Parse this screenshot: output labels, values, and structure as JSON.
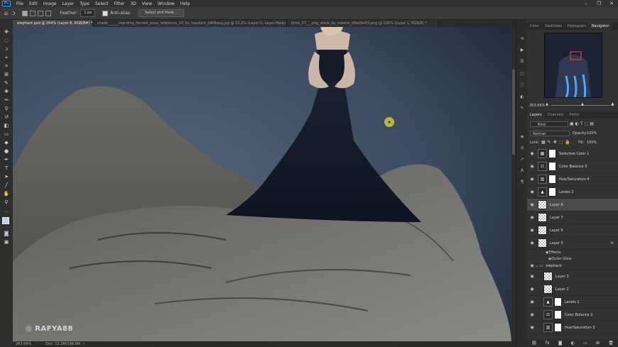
{
  "menu": {
    "items": [
      "File",
      "Edit",
      "Image",
      "Layer",
      "Type",
      "Select",
      "Filter",
      "3D",
      "View",
      "Window",
      "Help"
    ],
    "window_controls": [
      "–",
      "❐",
      "✕"
    ]
  },
  "options": {
    "feather_label": "Feather:",
    "feather_value": "1 px",
    "antialias_label": "Anti-alias",
    "select_mask_label": "Select and Mask..."
  },
  "tabs": [
    {
      "label": "elephant.psd @ 264% (Layer 8, RGB/8#) *",
      "active": true
    },
    {
      "label": "shade______standing_female_pose_reference_10_by_faeslock_d4ll6qsq.jpg @ 15.2% (Layer 0, Layer Mask/8) *",
      "active": false
    },
    {
      "label": "birds_07___png_stock_by_solanis_d9ejtbx03.png @ 100% (Layer 1, RGB/8) *",
      "active": false
    }
  ],
  "status": {
    "zoom": "263.66%",
    "doc": "Doc: 22.3M/196.6M"
  },
  "watermark": "RAFYA88",
  "right_panel": {
    "top_tabs": [
      "Color",
      "Swatches",
      "Histogram",
      "Navigator"
    ],
    "top_active": "Navigator",
    "nav_zoom": "263.66%",
    "layers_tabs": [
      "Layers",
      "Channels",
      "Paths"
    ],
    "layers_active": "Layers",
    "kind_label": "Kind",
    "blend_mode": "Normal",
    "opacity_label": "Opacity:",
    "opacity_value": "100%",
    "lock_label": "Lock:",
    "fill_label": "Fill:",
    "fill_value": "100%",
    "layers": [
      {
        "name": "Selective Color 1",
        "thumb": "adj",
        "icon": "▦",
        "mask": true,
        "selected": false
      },
      {
        "name": "Color Balance 3",
        "thumb": "adj",
        "icon": "⚖",
        "mask": true,
        "selected": false
      },
      {
        "name": "Hue/Saturation 4",
        "thumb": "adj",
        "icon": "▥",
        "mask": true,
        "selected": false
      },
      {
        "name": "Levels 2",
        "thumb": "adj",
        "icon": "▲",
        "mask": true,
        "selected": false
      },
      {
        "name": "Layer 8",
        "thumb": "ck",
        "icon": "",
        "mask": false,
        "selected": true
      },
      {
        "name": "Layer 7",
        "thumb": "ck",
        "icon": "",
        "mask": false,
        "selected": false
      },
      {
        "name": "Layer 6",
        "thumb": "ck",
        "icon": "",
        "mask": false,
        "selected": false
      },
      {
        "name": "Layer 5",
        "thumb": "ck",
        "icon": "",
        "mask": false,
        "selected": false,
        "fx": "fx"
      }
    ],
    "effects_label": "Effects",
    "outer_glow_label": "Outer Glow",
    "group_name": "elephant",
    "group_layers": [
      {
        "name": "Layer 3",
        "thumb": "ck",
        "icon": "",
        "mask": false
      },
      {
        "name": "Layer 2",
        "thumb": "ck",
        "icon": "",
        "mask": false
      },
      {
        "name": "Levels 1",
        "thumb": "adj",
        "icon": "▲",
        "mask": true
      },
      {
        "name": "Color Balance 2",
        "thumb": "adj",
        "icon": "⚖",
        "mask": true
      },
      {
        "name": "Hue/Saturation 3",
        "thumb": "adj",
        "icon": "▥",
        "mask": true
      }
    ],
    "bottom_icons": [
      "link-icon",
      "fx-icon",
      "mask-icon",
      "adjustment-icon",
      "folder-icon",
      "new-layer-icon",
      "trash-icon"
    ]
  }
}
